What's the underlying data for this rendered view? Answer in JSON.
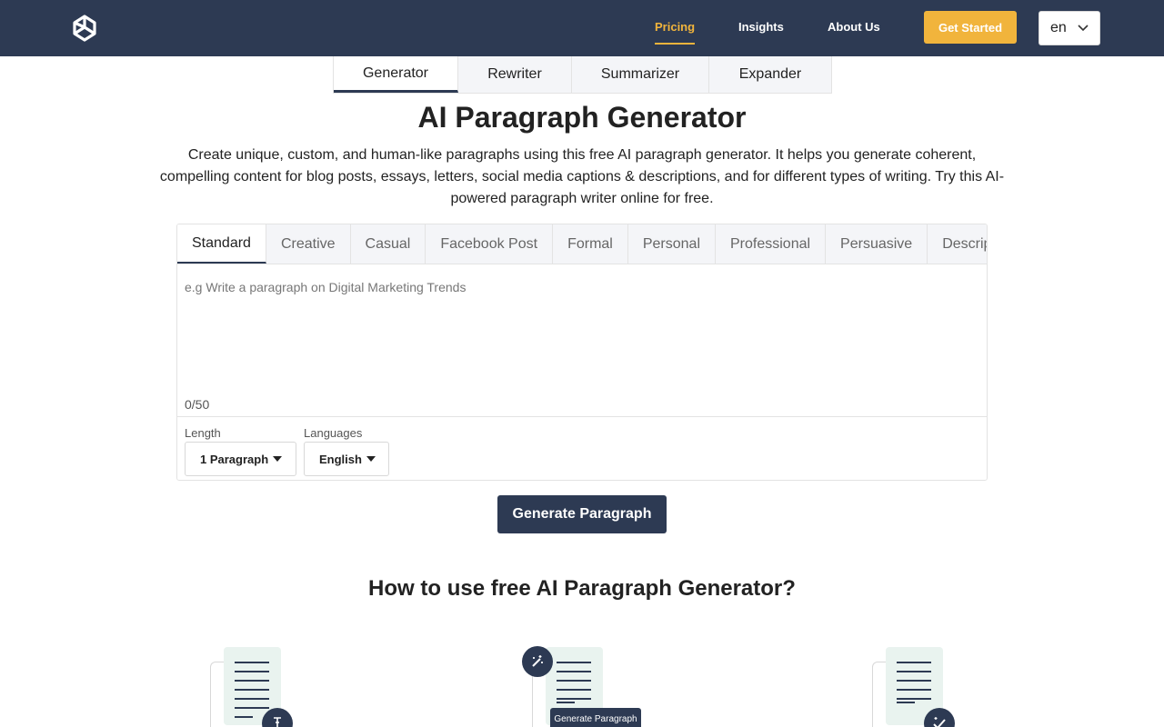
{
  "header": {
    "nav": [
      {
        "label": "Pricing",
        "active": true
      },
      {
        "label": "Insights",
        "active": false
      },
      {
        "label": "About Us",
        "active": false
      }
    ],
    "cta_label": "Get Started",
    "language": "en"
  },
  "tool_tabs": [
    {
      "label": "Generator",
      "active": true
    },
    {
      "label": "Rewriter",
      "active": false
    },
    {
      "label": "Summarizer",
      "active": false
    },
    {
      "label": "Expander",
      "active": false
    }
  ],
  "hero": {
    "title": "AI Paragraph Generator",
    "description": "Create unique, custom, and human-like paragraphs using this free AI paragraph generator. It helps you generate coherent, compelling content for blog posts, essays, letters, social media captions & descriptions, and for different types of writing. Try this AI-powered paragraph writer online for free."
  },
  "editor": {
    "tones": [
      {
        "label": "Standard",
        "active": true
      },
      {
        "label": "Creative",
        "active": false
      },
      {
        "label": "Casual",
        "active": false
      },
      {
        "label": "Facebook Post",
        "active": false
      },
      {
        "label": "Formal",
        "active": false
      },
      {
        "label": "Personal",
        "active": false
      },
      {
        "label": "Professional",
        "active": false
      },
      {
        "label": "Persuasive",
        "active": false
      },
      {
        "label": "Descriptive",
        "active": false
      }
    ],
    "placeholder": "e.g Write a paragraph on Digital Marketing Trends",
    "value": "",
    "counter": "0/50",
    "length_label": "Length",
    "length_value": "1 Paragraph",
    "languages_label": "Languages",
    "languages_value": "English"
  },
  "generate_label": "Generate Paragraph",
  "howto": {
    "title": "How to use free AI Paragraph Generator?",
    "mini_button": "Generate Paragraph",
    "icons": [
      "text-cursor-icon",
      "magic-wand-icon",
      "magic-check-icon"
    ]
  },
  "colors": {
    "navy": "#2d3a53",
    "accent": "#f1b43c",
    "paper": "#e9f3ef"
  }
}
